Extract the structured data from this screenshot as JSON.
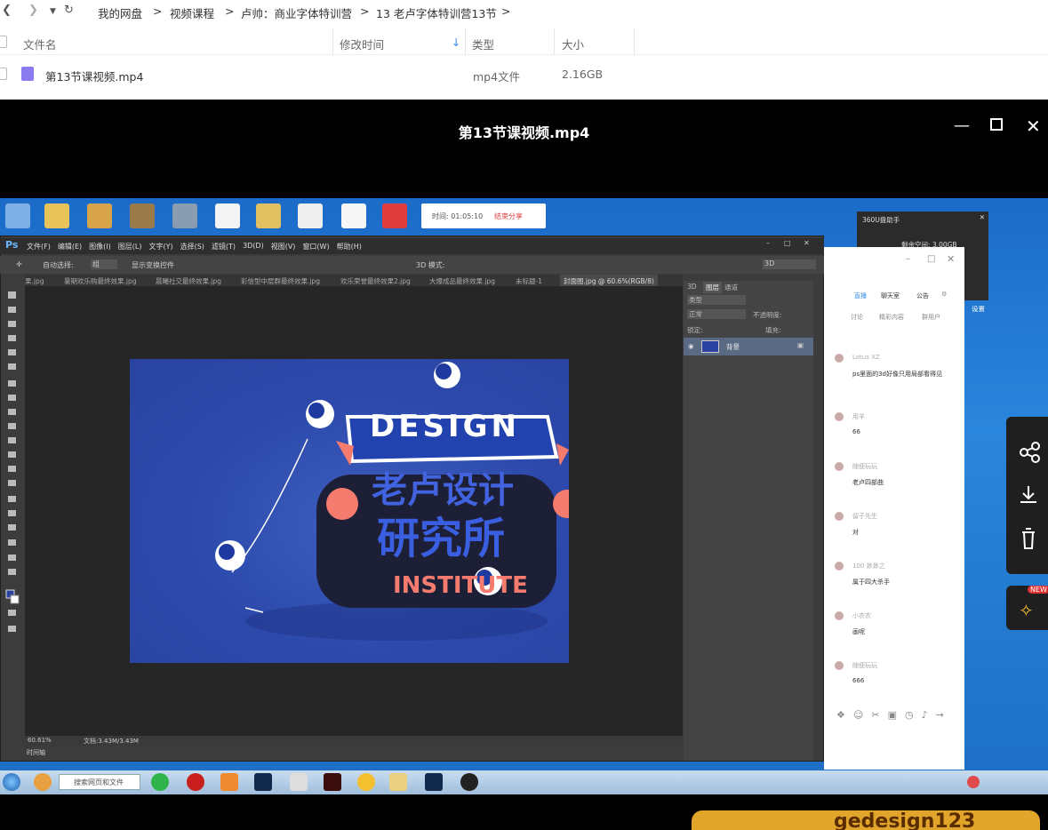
{
  "nav": {
    "breadcrumbs": [
      "我的网盘",
      "视频课程",
      "卢帅：商业字体特训营",
      "13 老卢字体特训营13节"
    ],
    "sep": ">"
  },
  "columns": {
    "name": "文件名",
    "modified": "修改时间",
    "type": "类型",
    "size": "大小"
  },
  "file": {
    "name": "第13节课视频.mp4",
    "type": "mp4文件",
    "size": "2.16GB"
  },
  "video": {
    "title": "第13节课视频.mp4"
  },
  "timer": {
    "time": "时间: 01:05:10",
    "end": "结束分享"
  },
  "ps": {
    "logo": "Ps",
    "menu": [
      "文件(F)",
      "编辑(E)",
      "图像(I)",
      "图层(L)",
      "文字(Y)",
      "选择(S)",
      "滤镜(T)",
      "3D(D)",
      "视图(V)",
      "窗口(W)",
      "帮助(H)"
    ],
    "options": {
      "auto_select": "自动选择:",
      "group": "组",
      "show_transform": "显示变换控件",
      "mode3d": "3D 模式:",
      "threed": "3D"
    },
    "tabs": [
      "果.jpg",
      "暑期欢乐购最终效果.jpg",
      "晨曦社交最终效果.jpg",
      "彩信型中层群最终效果.jpg",
      "欢乐荣誉最终效果2.jpg",
      "大爆成品最终效果.jpg",
      "未标题-1",
      "封面图.jpg @ 60.6%(RGB/8)"
    ],
    "status": {
      "zoom": "60.61%",
      "doc": "文档:3.43M/3.43M"
    },
    "timeline": "时间轴",
    "panels": {
      "tabs": [
        "3D",
        "图层",
        "通道"
      ],
      "kind": "类型",
      "blend": "正常",
      "opacity": "不透明度:",
      "lock": "锁定:",
      "fill": "填充:",
      "layer": "背景"
    }
  },
  "chat": {
    "tabs": [
      "直播",
      "聊天室",
      "公告"
    ],
    "subtabs": [
      "讨论",
      "精彩内容",
      "群用户"
    ],
    "messages": [
      {
        "user": "Lotus XZ",
        "text": "ps里面的3d好像只用局部看得见"
      },
      {
        "user": "用羊",
        "text": "66"
      },
      {
        "user": "随便玩玩",
        "text": "老卢四部曲"
      },
      {
        "user": "留子先生",
        "text": "对"
      },
      {
        "user": "100 渺渺之",
        "text": "属于四大杀手"
      },
      {
        "user": "小农农",
        "text": "画呢"
      },
      {
        "user": "随便玩玩",
        "text": "666"
      }
    ]
  },
  "assistant": {
    "title": "360U盘助手",
    "free": "剩余空间: 3.00GB",
    "settings": "设置"
  },
  "taskbar": {
    "search": "搜索网页和文件"
  },
  "side": {
    "badge": "NEW"
  },
  "art": {
    "design": "DESIGN",
    "line1": "老卢设计",
    "line2": "研究所",
    "institute": "INSTITUTE"
  },
  "watermark": "gedesign123"
}
